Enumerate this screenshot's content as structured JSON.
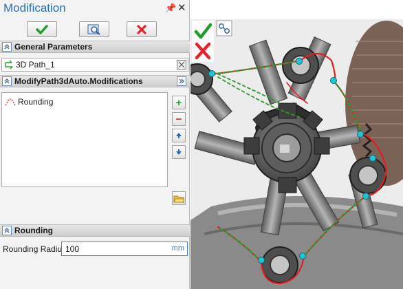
{
  "panel": {
    "title": "Modification",
    "toolbar": {
      "ok": "check-icon",
      "preview": "preview-icon",
      "cancel": "cancel-icon"
    },
    "general": {
      "title": "General Parameters",
      "path_value": "3D Path_1"
    },
    "modifications": {
      "title": "ModifyPath3dAuto.Modifications",
      "items": [
        "Rounding"
      ]
    },
    "rounding": {
      "title": "Rounding",
      "radius_label": "Rounding Radius:",
      "radius_value": "100",
      "unit": "mm"
    }
  },
  "colors": {
    "accent_title": "#2b6cb3",
    "ok_green": "#1f9e2c",
    "cancel_red": "#e0252c",
    "path_red": "#e02020",
    "path_green": "#2e9a2e",
    "node_cyan": "#22c4d4"
  }
}
